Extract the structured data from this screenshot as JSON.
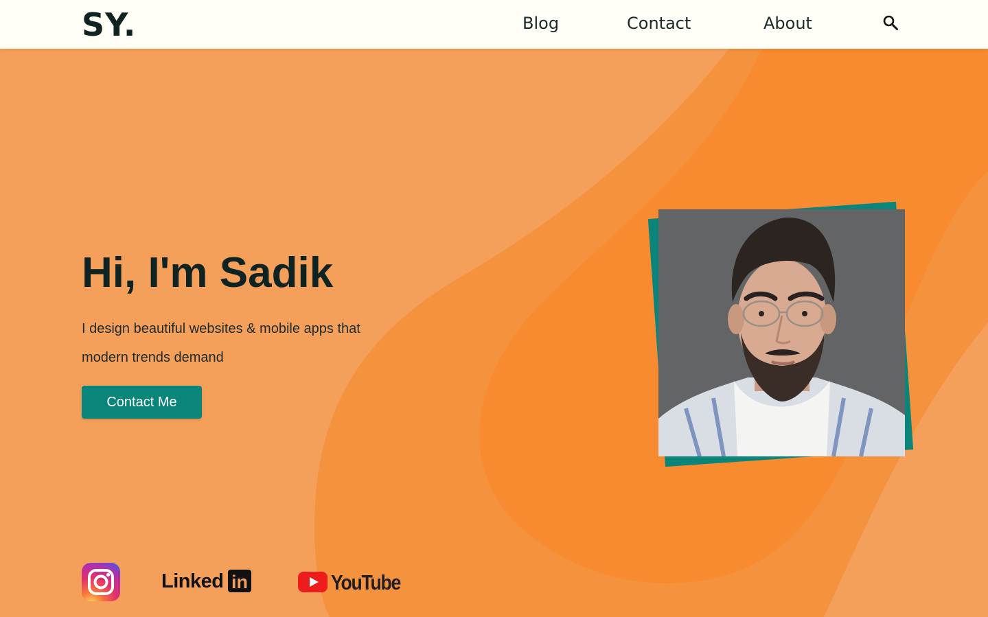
{
  "brand": {
    "logo": "SY."
  },
  "nav": {
    "links": [
      {
        "label": "Blog"
      },
      {
        "label": "Contact"
      },
      {
        "label": "About"
      }
    ],
    "search_icon": "search-icon"
  },
  "hero": {
    "title": "Hi, I'm Sadik",
    "subtitle": "I design beautiful websites & mobile apps that modern trends demand",
    "cta_label": "Contact Me"
  },
  "profile_photo": {
    "subject": "profile-photo"
  },
  "social": {
    "instagram_icon": "instagram-icon",
    "linkedin": {
      "word": "Linked",
      "badge": "in"
    },
    "youtube": {
      "word": "YouTube"
    }
  },
  "colors": {
    "background": "#f4a05b",
    "blob": "#f88b30",
    "header_bg": "#fffff8",
    "accent_teal": "#0a8579",
    "text_dark": "#0f2422"
  }
}
